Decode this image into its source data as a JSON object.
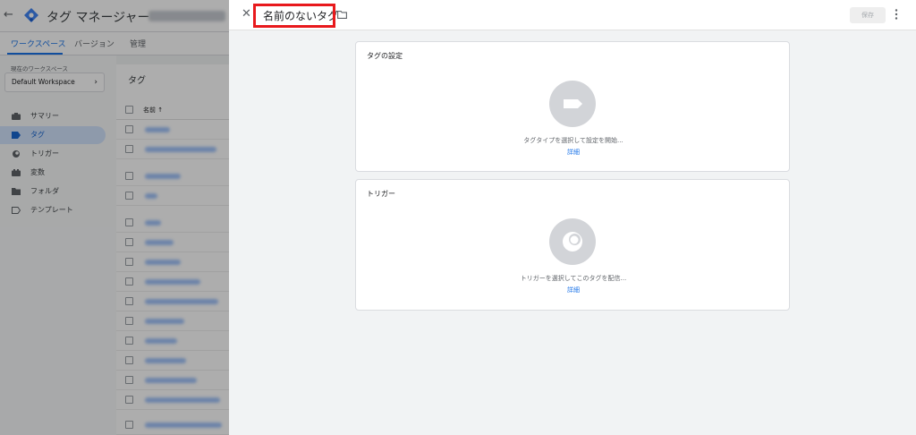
{
  "app": {
    "title": "タグ マネージャー",
    "tabs": [
      {
        "label": "ワークスペース",
        "active": true
      },
      {
        "label": "バージョン",
        "active": false
      },
      {
        "label": "管理",
        "active": false
      }
    ],
    "workspace_label": "現在のワークスペース",
    "workspace_name": "Default Workspace",
    "sidebar": [
      {
        "label": "サマリー",
        "icon": "briefcase-icon",
        "active": false
      },
      {
        "label": "タグ",
        "icon": "tag-icon",
        "active": true
      },
      {
        "label": "トリガー",
        "icon": "trigger-icon",
        "active": false
      },
      {
        "label": "変数",
        "icon": "variables-icon",
        "active": false
      },
      {
        "label": "フォルダ",
        "icon": "folder-icon",
        "active": false
      },
      {
        "label": "テンプレート",
        "icon": "template-icon",
        "active": false
      }
    ],
    "list_title": "タグ",
    "column_name": "名前 ↑"
  },
  "panel": {
    "tag_name": "名前のないタグ",
    "save_label": "保存",
    "tag_config": {
      "title": "タグの設定",
      "hint": "タグタイプを選択して設定を開始...",
      "link": "詳細"
    },
    "trigger": {
      "title": "トリガー",
      "hint": "トリガーを選択してこのタグを配信...",
      "link": "詳細"
    }
  },
  "colors": {
    "accent": "#1a73e8",
    "highlight_box": "#e8191c",
    "overlay": "rgba(0,0,0,0.32)"
  }
}
